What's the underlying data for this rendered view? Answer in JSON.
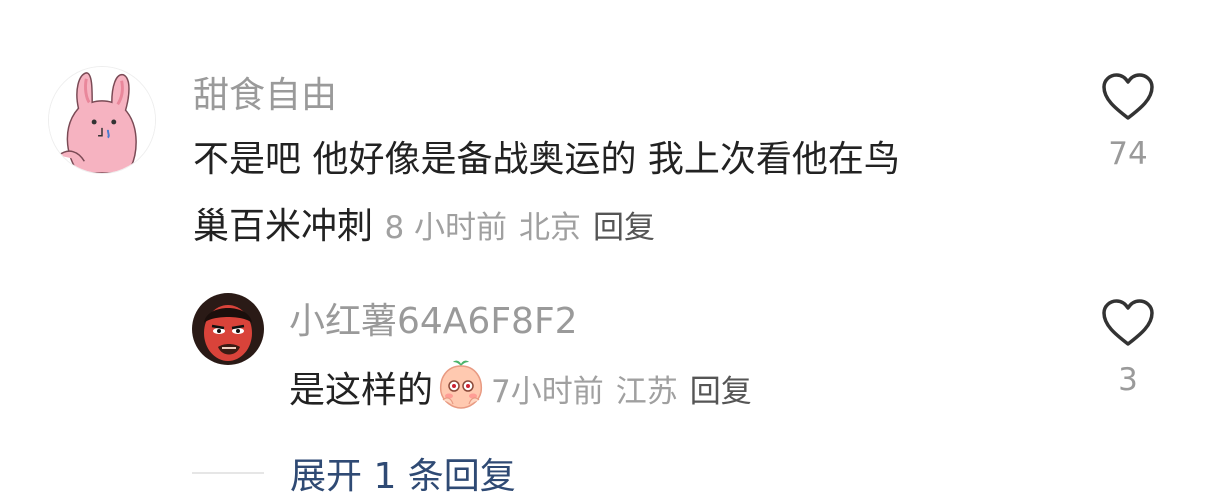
{
  "comment": {
    "username": "甜食自由",
    "text_line1": "不是吧 他好像是备战奥运的 我上次看他在鸟",
    "text_line2": "巢百米冲刺",
    "time": "8 小时前",
    "location": "北京",
    "reply_label": "回复",
    "like_count": "74",
    "avatar": "pink-bunny-avatar"
  },
  "reply": {
    "username": "小红薯64A6F8F2",
    "text": "是这样的",
    "sticker": "peach-shy-sticker",
    "time": "7小时前",
    "location": "江苏",
    "reply_label": "回复",
    "like_count": "3",
    "avatar": "red-face-avatar"
  },
  "expand": {
    "label": "展开 1 条回复",
    "color": "#2f4a74"
  },
  "colors": {
    "username": "#9a9a9a",
    "text": "#222222",
    "meta": "#a0a0a0"
  }
}
